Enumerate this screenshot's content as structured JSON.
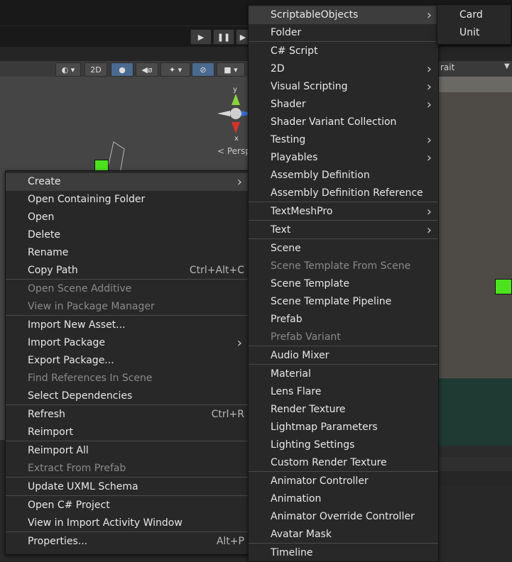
{
  "toolbar": {
    "play_icon": "play-icon",
    "pause_icon": "pause-icon",
    "step_icon": "step-icon",
    "scene_tools": {
      "mode_2d": "2D"
    }
  },
  "scene": {
    "gizmo_y": "y",
    "gizmo_x": "x",
    "perspective_label": "< Persp"
  },
  "game": {
    "aspect_label": "rait"
  },
  "context_menu": {
    "items": [
      {
        "label": "Create",
        "shortcut": "",
        "submenu": true,
        "disabled": false,
        "highlighted": true
      },
      {
        "label": "Open Containing Folder",
        "shortcut": "",
        "submenu": false,
        "disabled": false
      },
      {
        "label": "Open",
        "shortcut": "",
        "submenu": false,
        "disabled": false
      },
      {
        "label": "Delete",
        "shortcut": "",
        "submenu": false,
        "disabled": false
      },
      {
        "label": "Rename",
        "shortcut": "",
        "submenu": false,
        "disabled": false
      },
      {
        "label": "Copy Path",
        "shortcut": "Ctrl+Alt+C",
        "submenu": false,
        "disabled": false
      },
      {
        "label": "Open Scene Additive",
        "shortcut": "",
        "submenu": false,
        "disabled": true
      },
      {
        "label": "View in Package Manager",
        "shortcut": "",
        "submenu": false,
        "disabled": true
      },
      {
        "label": "Import New Asset...",
        "shortcut": "",
        "submenu": false,
        "disabled": false
      },
      {
        "label": "Import Package",
        "shortcut": "",
        "submenu": true,
        "disabled": false
      },
      {
        "label": "Export Package...",
        "shortcut": "",
        "submenu": false,
        "disabled": false
      },
      {
        "label": "Find References In Scene",
        "shortcut": "",
        "submenu": false,
        "disabled": true
      },
      {
        "label": "Select Dependencies",
        "shortcut": "",
        "submenu": false,
        "disabled": false
      },
      {
        "label": "Refresh",
        "shortcut": "Ctrl+R",
        "submenu": false,
        "disabled": false
      },
      {
        "label": "Reimport",
        "shortcut": "",
        "submenu": false,
        "disabled": false
      },
      {
        "label": "Reimport All",
        "shortcut": "",
        "submenu": false,
        "disabled": false
      },
      {
        "label": "Extract From Prefab",
        "shortcut": "",
        "submenu": false,
        "disabled": true
      },
      {
        "label": "Update UXML Schema",
        "shortcut": "",
        "submenu": false,
        "disabled": false
      },
      {
        "label": "Open C# Project",
        "shortcut": "",
        "submenu": false,
        "disabled": false
      },
      {
        "label": "View in Import Activity Window",
        "shortcut": "",
        "submenu": false,
        "disabled": false
      },
      {
        "label": "Properties...",
        "shortcut": "Alt+P",
        "submenu": false,
        "disabled": false
      }
    ]
  },
  "create_menu": {
    "items": [
      {
        "label": "ScriptableObjects",
        "submenu": true,
        "disabled": false,
        "highlighted": true
      },
      {
        "label": "Folder",
        "submenu": false,
        "disabled": false
      },
      {
        "label": "C# Script",
        "submenu": false,
        "disabled": false
      },
      {
        "label": "2D",
        "submenu": true,
        "disabled": false
      },
      {
        "label": "Visual Scripting",
        "submenu": true,
        "disabled": false
      },
      {
        "label": "Shader",
        "submenu": true,
        "disabled": false
      },
      {
        "label": "Shader Variant Collection",
        "submenu": false,
        "disabled": false
      },
      {
        "label": "Testing",
        "submenu": true,
        "disabled": false
      },
      {
        "label": "Playables",
        "submenu": true,
        "disabled": false
      },
      {
        "label": "Assembly Definition",
        "submenu": false,
        "disabled": false
      },
      {
        "label": "Assembly Definition Reference",
        "submenu": false,
        "disabled": false
      },
      {
        "label": "TextMeshPro",
        "submenu": true,
        "disabled": false
      },
      {
        "label": "Text",
        "submenu": true,
        "disabled": false
      },
      {
        "label": "Scene",
        "submenu": false,
        "disabled": false
      },
      {
        "label": "Scene Template From Scene",
        "submenu": false,
        "disabled": true
      },
      {
        "label": "Scene Template",
        "submenu": false,
        "disabled": false
      },
      {
        "label": "Scene Template Pipeline",
        "submenu": false,
        "disabled": false
      },
      {
        "label": "Prefab",
        "submenu": false,
        "disabled": false
      },
      {
        "label": "Prefab Variant",
        "submenu": false,
        "disabled": true
      },
      {
        "label": "Audio Mixer",
        "submenu": false,
        "disabled": false
      },
      {
        "label": "Material",
        "submenu": false,
        "disabled": false
      },
      {
        "label": "Lens Flare",
        "submenu": false,
        "disabled": false
      },
      {
        "label": "Render Texture",
        "submenu": false,
        "disabled": false
      },
      {
        "label": "Lightmap Parameters",
        "submenu": false,
        "disabled": false
      },
      {
        "label": "Lighting Settings",
        "submenu": false,
        "disabled": false
      },
      {
        "label": "Custom Render Texture",
        "submenu": false,
        "disabled": false
      },
      {
        "label": "Animator Controller",
        "submenu": false,
        "disabled": false
      },
      {
        "label": "Animation",
        "submenu": false,
        "disabled": false
      },
      {
        "label": "Animator Override Controller",
        "submenu": false,
        "disabled": false
      },
      {
        "label": "Avatar Mask",
        "submenu": false,
        "disabled": false
      },
      {
        "label": "Timeline",
        "submenu": false,
        "disabled": false
      }
    ]
  },
  "scriptable_menu": {
    "items": [
      {
        "label": "Card"
      },
      {
        "label": "Unit"
      }
    ]
  },
  "colors": {
    "menu_bg": "#282828",
    "highlight": "#3d3d3d",
    "disabled_text": "#8a8a8a",
    "green_object": "#4ce21e",
    "active_tool": "#4a6a8f"
  }
}
